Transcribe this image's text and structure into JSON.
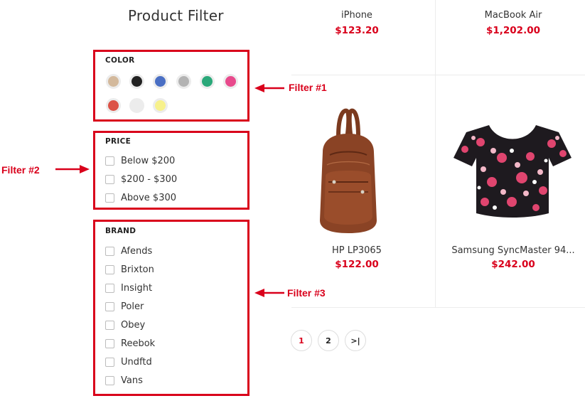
{
  "sidebar": {
    "title": "Product Filter",
    "color": {
      "heading": "COLOR",
      "swatches": [
        "#d3b99c",
        "#222222",
        "#4a6fc4",
        "#b3b3b3",
        "#2aa879",
        "#e84a8c",
        "#dc5246",
        "#ececec",
        "#f7f18c"
      ]
    },
    "price": {
      "heading": "PRICE",
      "options": [
        "Below $200",
        "$200 - $300",
        "Above $300"
      ]
    },
    "brand": {
      "heading": "BRAND",
      "options": [
        "Afends",
        "Brixton",
        "Insight",
        "Poler",
        "Obey",
        "Reebok",
        "Undftd",
        "Vans"
      ]
    }
  },
  "callouts": {
    "filter1": "Filter #1",
    "filter2": "Filter #2",
    "filter3": "Filter #3"
  },
  "products": [
    {
      "name": "iPhone",
      "price": "$123.20"
    },
    {
      "name": "MacBook Air",
      "price": "$1,202.00"
    },
    {
      "name": "HP LP3065",
      "price": "$122.00"
    },
    {
      "name": "Samsung SyncMaster 94...",
      "price": "$242.00"
    }
  ],
  "pagination": {
    "page1": "1",
    "page2": "2",
    "last": ">|"
  },
  "colors": {
    "accent": "#d9001b"
  }
}
